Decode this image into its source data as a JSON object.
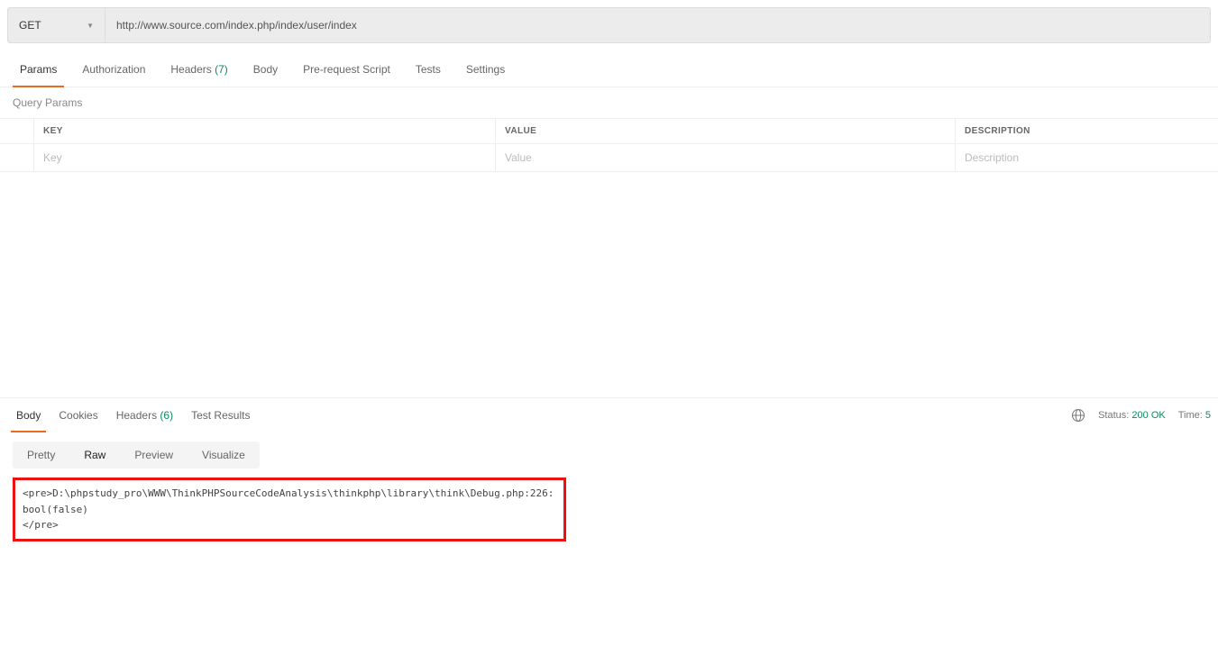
{
  "request": {
    "method": "GET",
    "url": "http://www.source.com/index.php/index/user/index"
  },
  "requestTabs": {
    "params": "Params",
    "authorization": "Authorization",
    "headers": "Headers",
    "headersCount": "(7)",
    "body": "Body",
    "prerequest": "Pre-request Script",
    "tests": "Tests",
    "settings": "Settings"
  },
  "querySection": {
    "title": "Query Params",
    "columns": {
      "key": "KEY",
      "value": "VALUE",
      "description": "DESCRIPTION"
    },
    "placeholders": {
      "key": "Key",
      "value": "Value",
      "description": "Description"
    }
  },
  "responseTabs": {
    "body": "Body",
    "cookies": "Cookies",
    "headers": "Headers",
    "headersCount": "(6)",
    "testResults": "Test Results"
  },
  "responseStatus": {
    "statusLabel": "Status:",
    "statusValue": "200 OK",
    "timeLabel": "Time:",
    "timeValue": "5"
  },
  "viewModes": {
    "pretty": "Pretty",
    "raw": "Raw",
    "preview": "Preview",
    "visualize": "Visualize"
  },
  "responseBody": "<pre>D:\\phpstudy_pro\\WWW\\ThinkPHPSourceCodeAnalysis\\thinkphp\\library\\think\\Debug.php:226:\nbool(false)\n</pre>"
}
